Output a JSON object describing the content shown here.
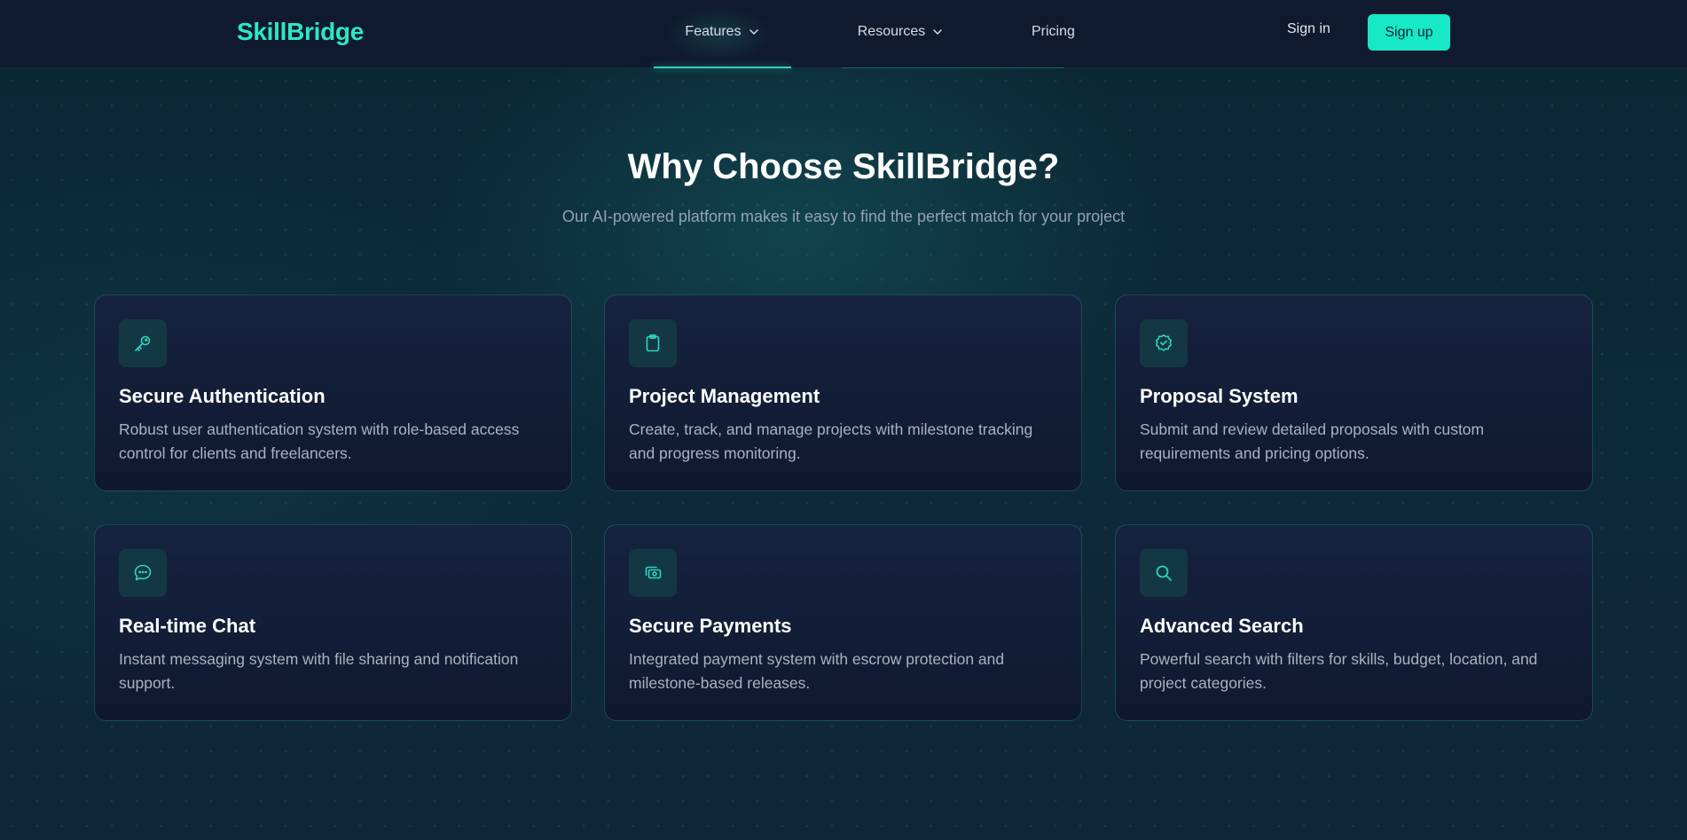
{
  "nav": {
    "logo": "SkillBridge",
    "links": [
      {
        "label": "Features",
        "icon": "chevron-down-icon"
      },
      {
        "label": "Resources",
        "icon": "chevron-down-icon"
      },
      {
        "label": "Pricing"
      }
    ],
    "sign_in": "Sign in",
    "sign_up": "Sign up"
  },
  "hero": {
    "title": "Why Choose SkillBridge?",
    "subtitle": "Our AI-powered platform makes it easy to find the perfect match for your project"
  },
  "features": [
    {
      "icon": "key-icon",
      "title": "Secure Authentication",
      "description": "Robust user authentication system with role-based access control for clients and freelancers."
    },
    {
      "icon": "clipboard-icon",
      "title": "Project Management",
      "description": "Create, track, and manage projects with milestone tracking and progress monitoring."
    },
    {
      "icon": "badge-check-icon",
      "title": "Proposal System",
      "description": "Submit and review detailed proposals with custom requirements and pricing options."
    },
    {
      "icon": "chat-bubble-icon",
      "title": "Real-time Chat",
      "description": "Instant messaging system with file sharing and notification support."
    },
    {
      "icon": "cash-icon",
      "title": "Secure Payments",
      "description": "Integrated payment system with escrow protection and milestone-based releases."
    },
    {
      "icon": "search-icon",
      "title": "Advanced Search",
      "description": "Powerful search with filters for skills, budget, location, and project categories."
    }
  ],
  "colors": {
    "accent": "#2dd4bf",
    "button": "#17e8c6",
    "nav_bg": "#101a2e",
    "card_bg": "#16233f"
  }
}
